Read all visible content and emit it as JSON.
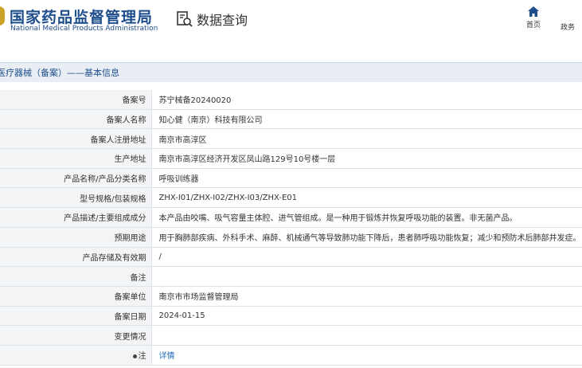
{
  "header": {
    "brand_title": "国家药品监督管理局",
    "brand_subtitle": "National Medical Products Administration",
    "query_label": "数据查询",
    "nav_home": "首页",
    "nav_policy": "政务"
  },
  "section": {
    "title": "医疗器械（备案）——基本信息"
  },
  "rows": [
    {
      "label": "备案号",
      "value": "苏宁械备20240020"
    },
    {
      "label": "备案人名称",
      "value": "知心健（南京）科技有限公司"
    },
    {
      "label": "备案人注册地址",
      "value": "南京市高淳区"
    },
    {
      "label": "生产地址",
      "value": "南京市高淳区经济开发区凤山路129号10号楼一层"
    },
    {
      "label": "产品名称/产品分类名称",
      "value": "呼吸训练器"
    },
    {
      "label": "型号规格/包装规格",
      "value": "ZHX-I01/ZHX-I02/ZHX-I03/ZHX-E01"
    },
    {
      "label": "产品描述/主要组成成分",
      "value": "本产品由咬嘴、吸气容量主体腔、进气管组成。是一种用于锻炼并恢复呼吸功能的装置。非无菌产品。"
    },
    {
      "label": "预期用途",
      "value": "用于胸肺部疾病、外科手术、麻醉、机械通气等导致肺功能下降后，患者肺呼吸功能恢复；减少和预防术后肺部并发症。"
    },
    {
      "label": "产品存储及有效期",
      "value": "/"
    },
    {
      "label": "备注",
      "value": ""
    },
    {
      "label": "备案单位",
      "value": "南京市市场监督管理局"
    },
    {
      "label": "备案日期",
      "value": "2024-01-15"
    },
    {
      "label": "变更情况",
      "value": ""
    }
  ],
  "note_row": {
    "label": "注",
    "link": "详情"
  },
  "colors": {
    "brand": "#1f4e8c",
    "link": "#1f6fbf",
    "label_bg": "#f2f4f6",
    "section_bg": "#e8eef3"
  }
}
